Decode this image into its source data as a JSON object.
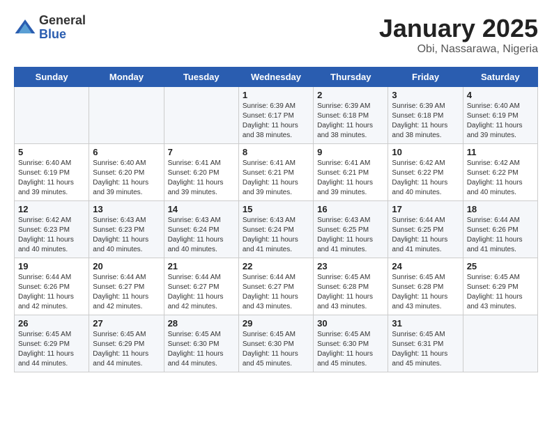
{
  "logo": {
    "general": "General",
    "blue": "Blue"
  },
  "title": "January 2025",
  "subtitle": "Obi, Nassarawa, Nigeria",
  "weekdays": [
    "Sunday",
    "Monday",
    "Tuesday",
    "Wednesday",
    "Thursday",
    "Friday",
    "Saturday"
  ],
  "weeks": [
    [
      {
        "day": "",
        "sunrise": "",
        "sunset": "",
        "daylight": ""
      },
      {
        "day": "",
        "sunrise": "",
        "sunset": "",
        "daylight": ""
      },
      {
        "day": "",
        "sunrise": "",
        "sunset": "",
        "daylight": ""
      },
      {
        "day": "1",
        "sunrise": "Sunrise: 6:39 AM",
        "sunset": "Sunset: 6:17 PM",
        "daylight": "Daylight: 11 hours and 38 minutes."
      },
      {
        "day": "2",
        "sunrise": "Sunrise: 6:39 AM",
        "sunset": "Sunset: 6:18 PM",
        "daylight": "Daylight: 11 hours and 38 minutes."
      },
      {
        "day": "3",
        "sunrise": "Sunrise: 6:39 AM",
        "sunset": "Sunset: 6:18 PM",
        "daylight": "Daylight: 11 hours and 38 minutes."
      },
      {
        "day": "4",
        "sunrise": "Sunrise: 6:40 AM",
        "sunset": "Sunset: 6:19 PM",
        "daylight": "Daylight: 11 hours and 39 minutes."
      }
    ],
    [
      {
        "day": "5",
        "sunrise": "Sunrise: 6:40 AM",
        "sunset": "Sunset: 6:19 PM",
        "daylight": "Daylight: 11 hours and 39 minutes."
      },
      {
        "day": "6",
        "sunrise": "Sunrise: 6:40 AM",
        "sunset": "Sunset: 6:20 PM",
        "daylight": "Daylight: 11 hours and 39 minutes."
      },
      {
        "day": "7",
        "sunrise": "Sunrise: 6:41 AM",
        "sunset": "Sunset: 6:20 PM",
        "daylight": "Daylight: 11 hours and 39 minutes."
      },
      {
        "day": "8",
        "sunrise": "Sunrise: 6:41 AM",
        "sunset": "Sunset: 6:21 PM",
        "daylight": "Daylight: 11 hours and 39 minutes."
      },
      {
        "day": "9",
        "sunrise": "Sunrise: 6:41 AM",
        "sunset": "Sunset: 6:21 PM",
        "daylight": "Daylight: 11 hours and 39 minutes."
      },
      {
        "day": "10",
        "sunrise": "Sunrise: 6:42 AM",
        "sunset": "Sunset: 6:22 PM",
        "daylight": "Daylight: 11 hours and 40 minutes."
      },
      {
        "day": "11",
        "sunrise": "Sunrise: 6:42 AM",
        "sunset": "Sunset: 6:22 PM",
        "daylight": "Daylight: 11 hours and 40 minutes."
      }
    ],
    [
      {
        "day": "12",
        "sunrise": "Sunrise: 6:42 AM",
        "sunset": "Sunset: 6:23 PM",
        "daylight": "Daylight: 11 hours and 40 minutes."
      },
      {
        "day": "13",
        "sunrise": "Sunrise: 6:43 AM",
        "sunset": "Sunset: 6:23 PM",
        "daylight": "Daylight: 11 hours and 40 minutes."
      },
      {
        "day": "14",
        "sunrise": "Sunrise: 6:43 AM",
        "sunset": "Sunset: 6:24 PM",
        "daylight": "Daylight: 11 hours and 40 minutes."
      },
      {
        "day": "15",
        "sunrise": "Sunrise: 6:43 AM",
        "sunset": "Sunset: 6:24 PM",
        "daylight": "Daylight: 11 hours and 41 minutes."
      },
      {
        "day": "16",
        "sunrise": "Sunrise: 6:43 AM",
        "sunset": "Sunset: 6:25 PM",
        "daylight": "Daylight: 11 hours and 41 minutes."
      },
      {
        "day": "17",
        "sunrise": "Sunrise: 6:44 AM",
        "sunset": "Sunset: 6:25 PM",
        "daylight": "Daylight: 11 hours and 41 minutes."
      },
      {
        "day": "18",
        "sunrise": "Sunrise: 6:44 AM",
        "sunset": "Sunset: 6:26 PM",
        "daylight": "Daylight: 11 hours and 41 minutes."
      }
    ],
    [
      {
        "day": "19",
        "sunrise": "Sunrise: 6:44 AM",
        "sunset": "Sunset: 6:26 PM",
        "daylight": "Daylight: 11 hours and 42 minutes."
      },
      {
        "day": "20",
        "sunrise": "Sunrise: 6:44 AM",
        "sunset": "Sunset: 6:27 PM",
        "daylight": "Daylight: 11 hours and 42 minutes."
      },
      {
        "day": "21",
        "sunrise": "Sunrise: 6:44 AM",
        "sunset": "Sunset: 6:27 PM",
        "daylight": "Daylight: 11 hours and 42 minutes."
      },
      {
        "day": "22",
        "sunrise": "Sunrise: 6:44 AM",
        "sunset": "Sunset: 6:27 PM",
        "daylight": "Daylight: 11 hours and 43 minutes."
      },
      {
        "day": "23",
        "sunrise": "Sunrise: 6:45 AM",
        "sunset": "Sunset: 6:28 PM",
        "daylight": "Daylight: 11 hours and 43 minutes."
      },
      {
        "day": "24",
        "sunrise": "Sunrise: 6:45 AM",
        "sunset": "Sunset: 6:28 PM",
        "daylight": "Daylight: 11 hours and 43 minutes."
      },
      {
        "day": "25",
        "sunrise": "Sunrise: 6:45 AM",
        "sunset": "Sunset: 6:29 PM",
        "daylight": "Daylight: 11 hours and 43 minutes."
      }
    ],
    [
      {
        "day": "26",
        "sunrise": "Sunrise: 6:45 AM",
        "sunset": "Sunset: 6:29 PM",
        "daylight": "Daylight: 11 hours and 44 minutes."
      },
      {
        "day": "27",
        "sunrise": "Sunrise: 6:45 AM",
        "sunset": "Sunset: 6:29 PM",
        "daylight": "Daylight: 11 hours and 44 minutes."
      },
      {
        "day": "28",
        "sunrise": "Sunrise: 6:45 AM",
        "sunset": "Sunset: 6:30 PM",
        "daylight": "Daylight: 11 hours and 44 minutes."
      },
      {
        "day": "29",
        "sunrise": "Sunrise: 6:45 AM",
        "sunset": "Sunset: 6:30 PM",
        "daylight": "Daylight: 11 hours and 45 minutes."
      },
      {
        "day": "30",
        "sunrise": "Sunrise: 6:45 AM",
        "sunset": "Sunset: 6:30 PM",
        "daylight": "Daylight: 11 hours and 45 minutes."
      },
      {
        "day": "31",
        "sunrise": "Sunrise: 6:45 AM",
        "sunset": "Sunset: 6:31 PM",
        "daylight": "Daylight: 11 hours and 45 minutes."
      },
      {
        "day": "",
        "sunrise": "",
        "sunset": "",
        "daylight": ""
      }
    ]
  ]
}
